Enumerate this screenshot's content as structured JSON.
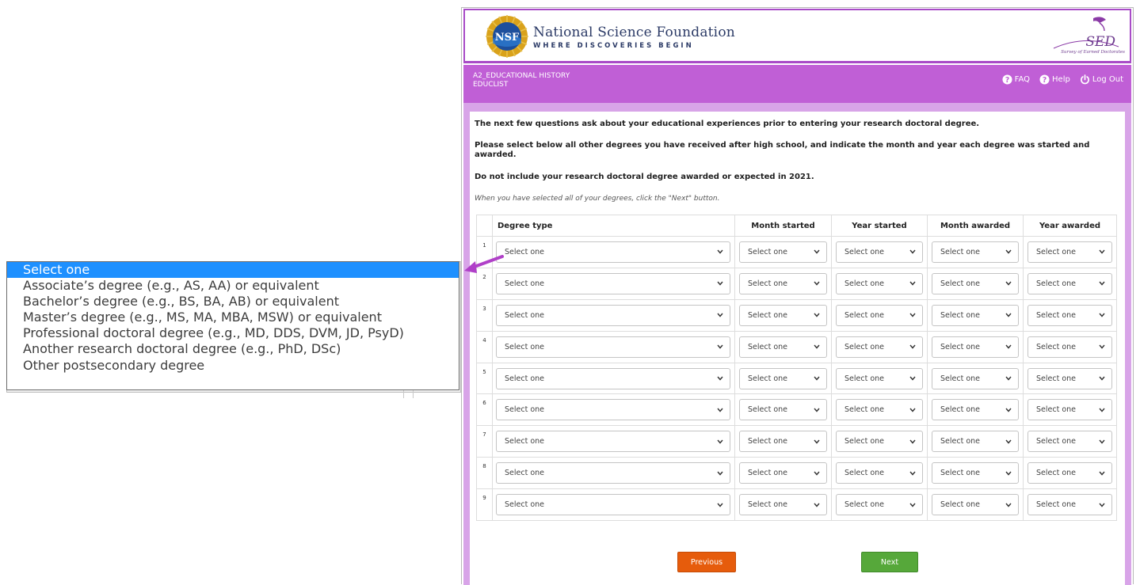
{
  "header": {
    "org_name": "National Science Foundation",
    "tagline": "WHERE DISCOVERIES BEGIN",
    "nsf_logo_text": "NSF",
    "survey_logo_text": "SED",
    "survey_logo_sub": "Survey of Earned Doctorates"
  },
  "section_bar": {
    "code_line1": "A2_EDUCATIONAL HISTORY",
    "code_line2": "EDUCLIST",
    "faq": "FAQ",
    "help": "Help",
    "logout": "Log Out"
  },
  "questions": {
    "intro": "The next few questions ask about your educational experiences prior to entering your research doctoral degree.",
    "instruction": "Please select below all other degrees you have received after high school, and indicate the month and year each degree was started and awarded.",
    "exclusion": "Do not include your research doctoral degree awarded or expected in 2021.",
    "hint": "When you have selected all of your degrees, click the \"Next\" button."
  },
  "table": {
    "headers": [
      "Degree type",
      "Month started",
      "Year started",
      "Month awarded",
      "Year awarded"
    ],
    "rows": [
      {
        "n": "1",
        "degree": "Select one",
        "month_started": "Select one",
        "year_started": "Select one",
        "month_awarded": "Select one",
        "year_awarded": "Select one"
      },
      {
        "n": "2",
        "degree": "Select one",
        "month_started": "Select one",
        "year_started": "Select one",
        "month_awarded": "Select one",
        "year_awarded": "Select one"
      },
      {
        "n": "3",
        "degree": "Select one",
        "month_started": "Select one",
        "year_started": "Select one",
        "month_awarded": "Select one",
        "year_awarded": "Select one"
      },
      {
        "n": "4",
        "degree": "Select one",
        "month_started": "Select one",
        "year_started": "Select one",
        "month_awarded": "Select one",
        "year_awarded": "Select one"
      },
      {
        "n": "5",
        "degree": "Select one",
        "month_started": "Select one",
        "year_started": "Select one",
        "month_awarded": "Select one",
        "year_awarded": "Select one"
      },
      {
        "n": "6",
        "degree": "Select one",
        "month_started": "Select one",
        "year_started": "Select one",
        "month_awarded": "Select one",
        "year_awarded": "Select one"
      },
      {
        "n": "7",
        "degree": "Select one",
        "month_started": "Select one",
        "year_started": "Select one",
        "month_awarded": "Select one",
        "year_awarded": "Select one"
      },
      {
        "n": "8",
        "degree": "Select one",
        "month_started": "Select one",
        "year_started": "Select one",
        "month_awarded": "Select one",
        "year_awarded": "Select one"
      },
      {
        "n": "9",
        "degree": "Select one",
        "month_started": "Select one",
        "year_started": "Select one",
        "month_awarded": "Select one",
        "year_awarded": "Select one"
      }
    ]
  },
  "degree_dropdown": {
    "selected_index": 0,
    "options": [
      "Select one",
      "Associate’s degree (e.g., AS, AA) or equivalent",
      "Bachelor’s degree (e.g., BS, BA, AB) or equivalent",
      "Master’s degree (e.g., MS, MA, MBA, MSW) or equivalent",
      "Professional doctoral degree (e.g., MD, DDS, DVM, JD, PsyD)",
      "Another research doctoral degree (e.g., PhD, DSc)",
      "Other postsecondary degree"
    ]
  },
  "buttons": {
    "previous": "Previous",
    "next": "Next"
  },
  "colors": {
    "header_bar": "#c05fd6",
    "header_border": "#a84bc7",
    "lavender_frame": "#d8a4e8",
    "dropdown_highlight": "#1e90ff",
    "previous_button": "#e65c0c",
    "next_button": "#56a83a",
    "callout_arrow": "#b040c8"
  },
  "icons": [
    "question-circle-icon",
    "power-icon",
    "chevron-down-icon",
    "callout-arrow-icon"
  ]
}
